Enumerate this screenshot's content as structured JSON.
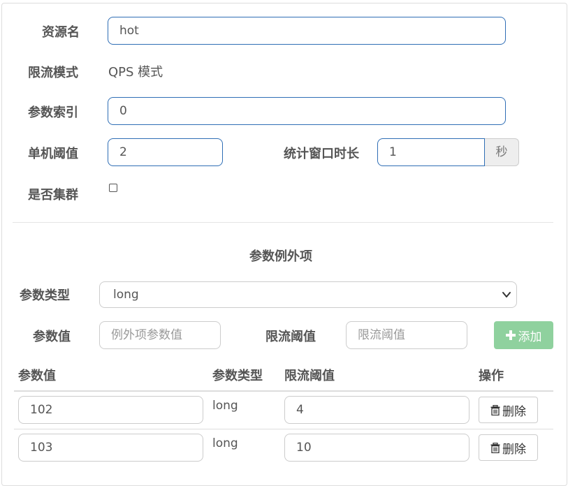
{
  "form": {
    "resource_label": "资源名",
    "resource_value": "hot",
    "mode_label": "限流模式",
    "mode_value": "QPS 模式",
    "param_index_label": "参数索引",
    "param_index_value": "0",
    "threshold_label": "单机阈值",
    "threshold_value": "2",
    "window_label": "统计窗口时长",
    "window_value": "1",
    "window_unit": "秒",
    "cluster_label": "是否集群",
    "cluster_checked": false
  },
  "exceptions": {
    "title": "参数例外项",
    "type_label": "参数类型",
    "type_selected": "long",
    "value_label": "参数值",
    "value_placeholder": "例外项参数值",
    "limit_label": "限流阈值",
    "limit_placeholder": "限流阈值",
    "add_label": "添加",
    "add_icon": "plus-icon"
  },
  "table": {
    "headers": [
      "参数值",
      "参数类型",
      "限流阈值",
      "操作"
    ],
    "rows": [
      {
        "value": "102",
        "type": "long",
        "limit": "4",
        "action": "删除"
      },
      {
        "value": "103",
        "type": "long",
        "limit": "10",
        "action": "删除"
      }
    ],
    "delete_icon": "trash-icon"
  },
  "colors": {
    "focus_border": "#2f6eb5",
    "add_button": "#8fd19e",
    "label_text": "#555555"
  }
}
